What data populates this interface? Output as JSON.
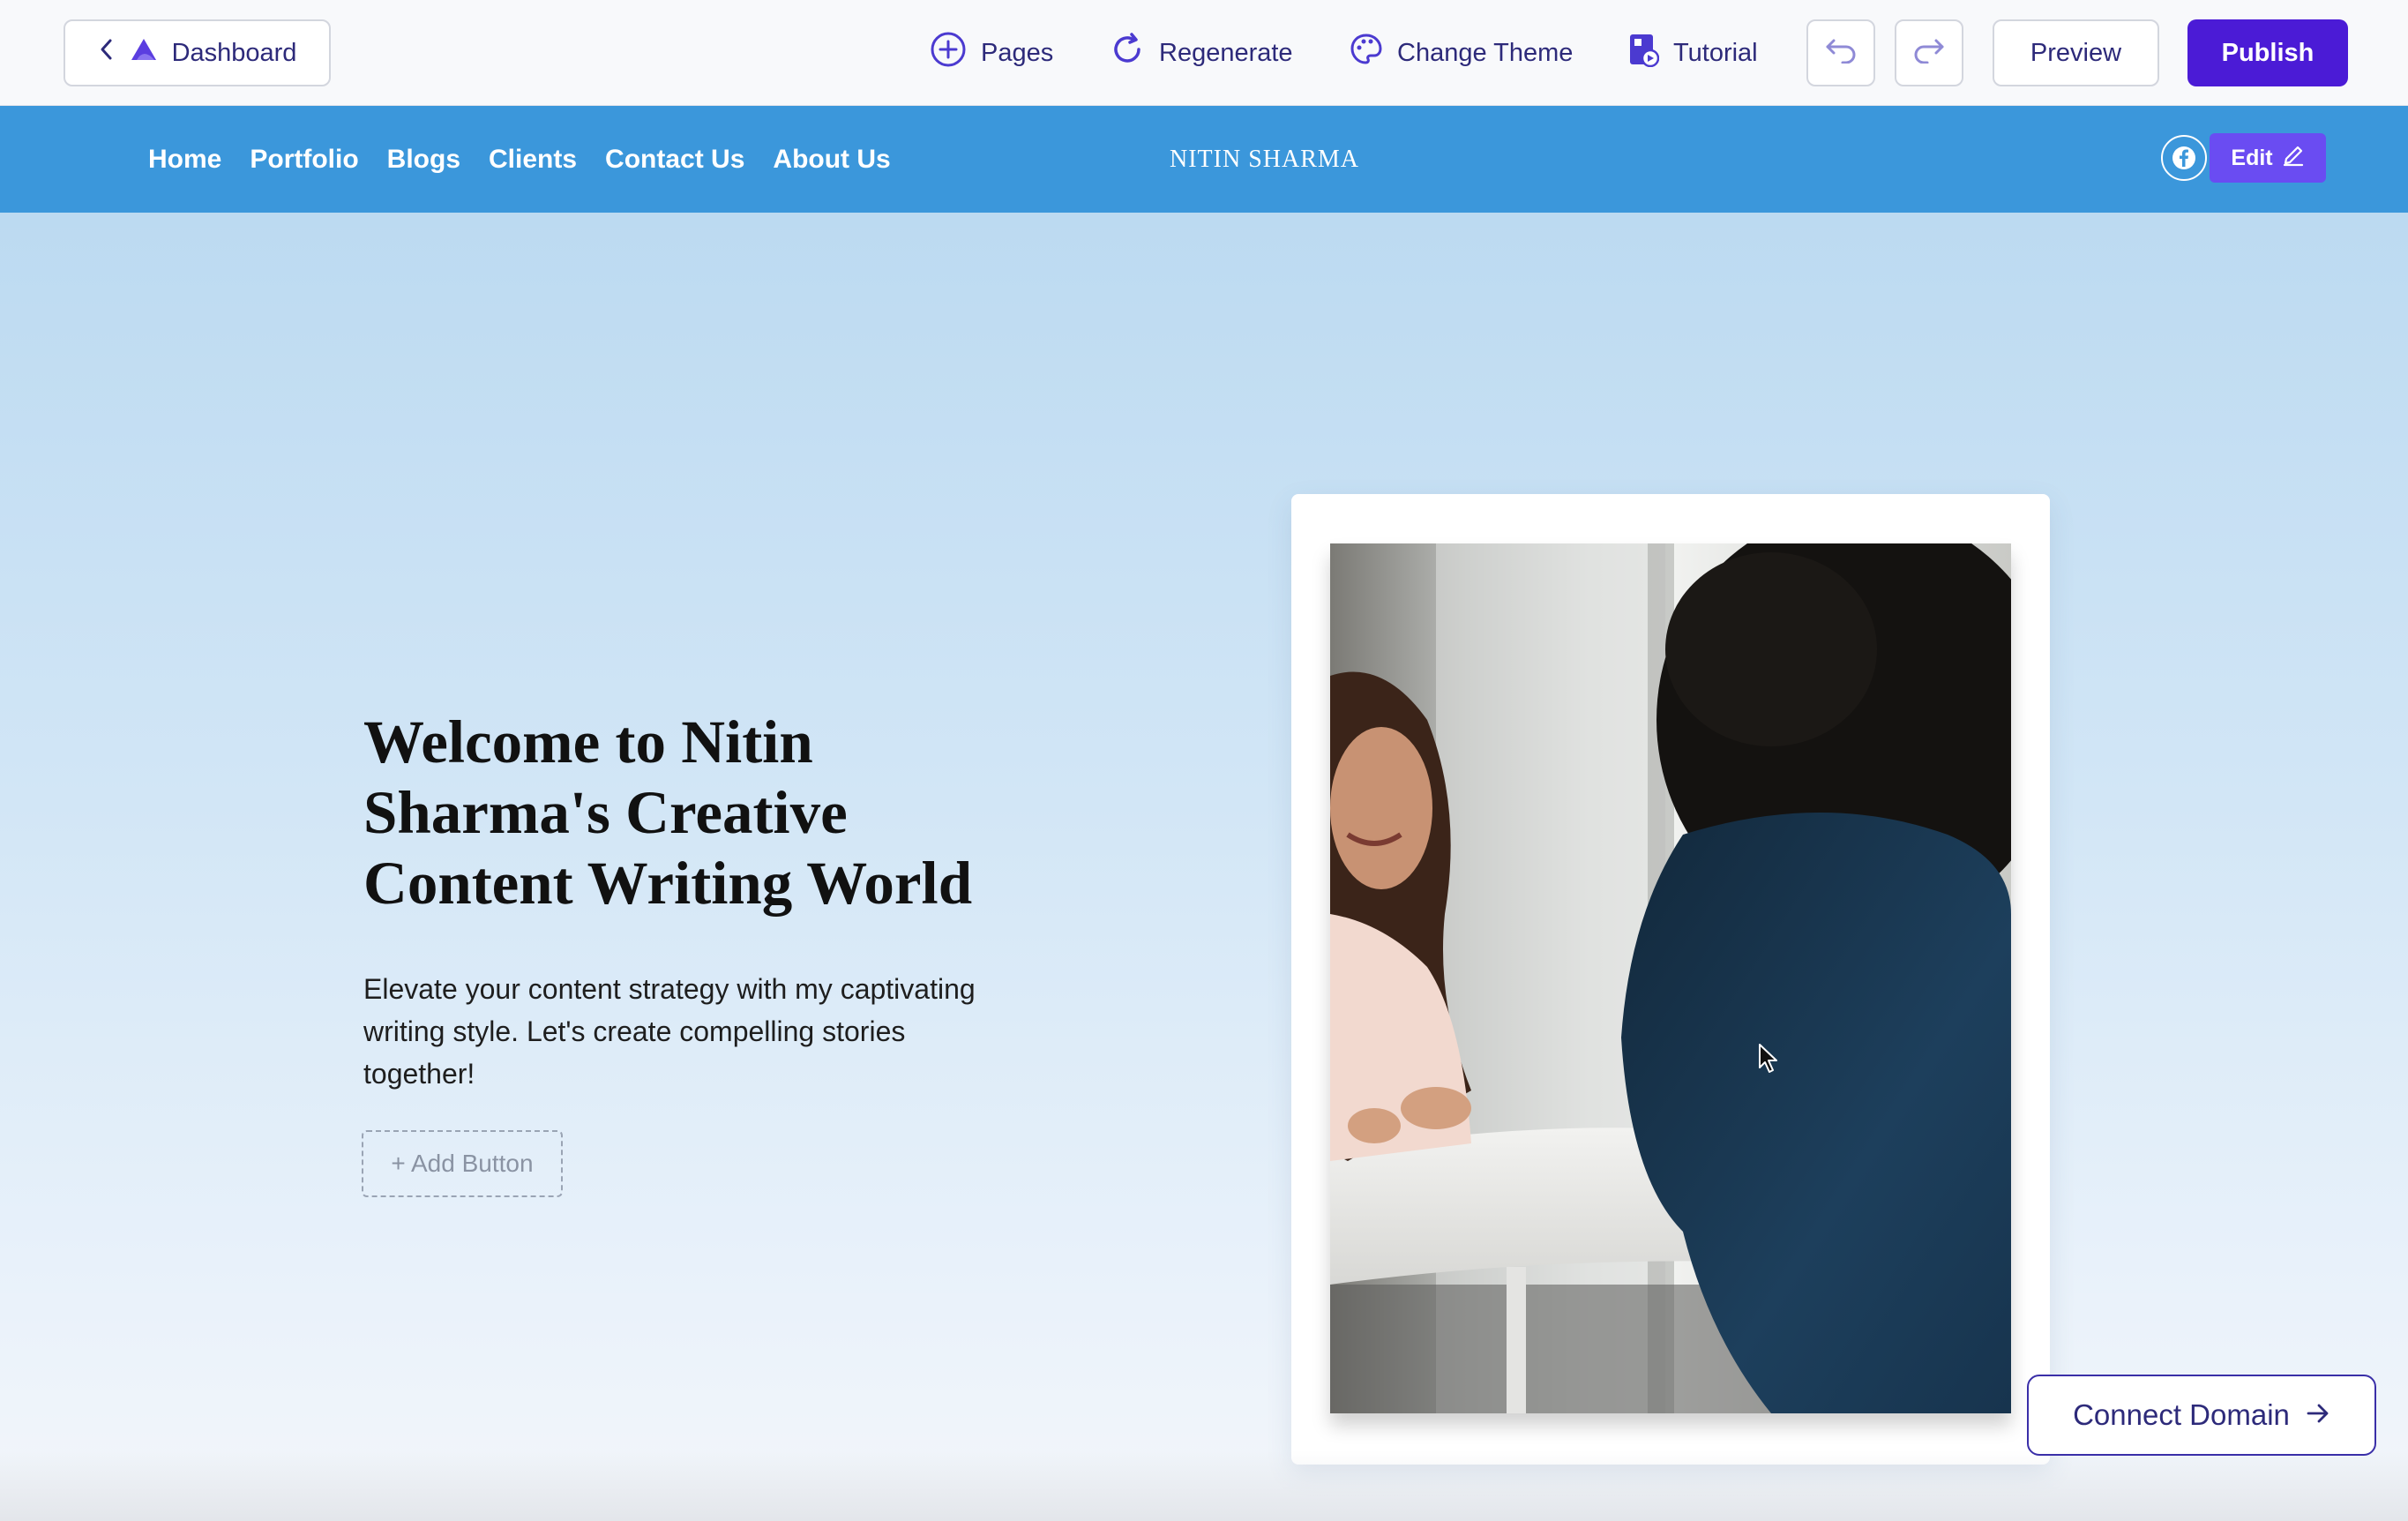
{
  "toolbar": {
    "dashboard_label": "Dashboard",
    "pages_label": "Pages",
    "regenerate_label": "Regenerate",
    "change_theme_label": "Change Theme",
    "tutorial_label": "Tutorial",
    "preview_label": "Preview",
    "publish_label": "Publish",
    "icons": [
      "chevron-left-icon",
      "logo-icon",
      "plus-circle-icon",
      "refresh-icon",
      "palette-icon",
      "tutorial-icon",
      "undo-icon",
      "redo-icon"
    ]
  },
  "site_nav": {
    "items": [
      "Home",
      "Portfolio",
      "Blogs",
      "Clients",
      "Contact Us",
      "About Us"
    ],
    "brand": "NITIN SHARMA",
    "edit_label": "Edit",
    "icons": [
      "facebook-icon",
      "pencil-icon"
    ]
  },
  "hero": {
    "title": "Welcome to Nitin Sharma's Creative Content Writing World",
    "text": "Elevate your content strategy with my captivating writing style. Let's create compelling stories together!",
    "add_button_label": "+ Add Button"
  },
  "connect_domain": {
    "label": "Connect Domain",
    "icon": "arrow-right-icon"
  },
  "colors": {
    "brand_accent": "#4b1bd6",
    "nav_background": "#3b97db",
    "toolbar_text": "#2d2a7a"
  }
}
